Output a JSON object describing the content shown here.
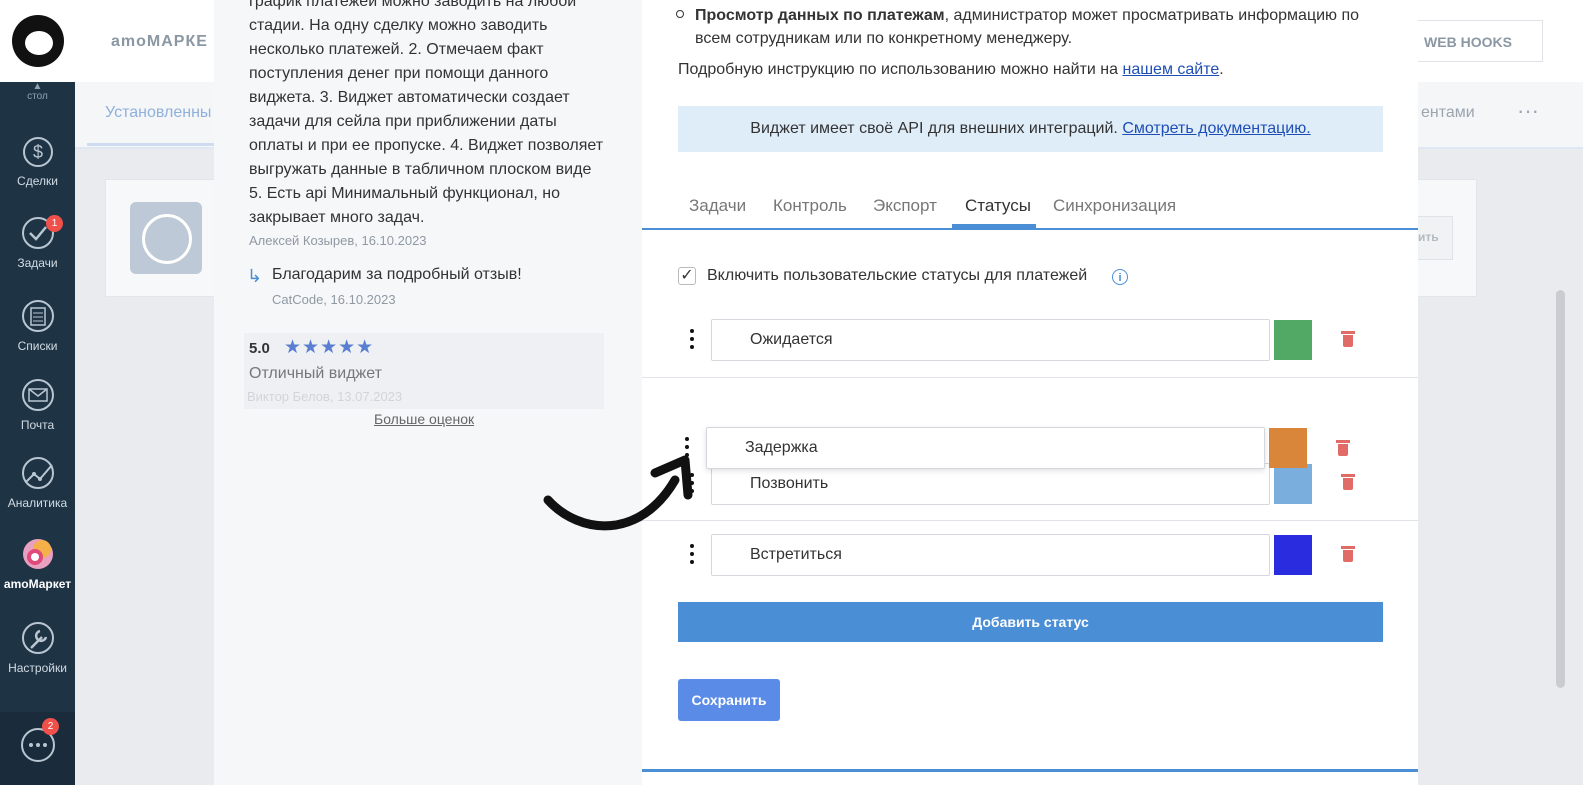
{
  "sidebar": {
    "collapse_label": "стол",
    "items": [
      {
        "label": "Сделки",
        "icon": "dollar-icon"
      },
      {
        "label": "Задачи",
        "icon": "checkmark-icon",
        "badge": "1"
      },
      {
        "label": "Списки",
        "icon": "list-icon"
      },
      {
        "label": "Почта",
        "icon": "mail-icon"
      },
      {
        "label": "Аналитика",
        "icon": "analytics-icon"
      },
      {
        "label": "amoМаркет",
        "icon": "market-icon",
        "active": true
      },
      {
        "label": "Настройки",
        "icon": "wrench-icon"
      }
    ],
    "chat_badge": "2"
  },
  "background": {
    "brand": "amoМАРКЕ",
    "webhooks_label": "WEB HOOKS",
    "tab_left": "Установленны",
    "tab_right": "ентами",
    "tab_more": "···",
    "card_button": "ить"
  },
  "review": {
    "text": "график платежей можно заводить на любой стадии. На одну сделку можно заводить несколько платежей. 2. Отмечаем факт поступления денег при помощи данного виджета. 3. Виджет автоматически создает задачи для сейла при приближении даты оплаты и при ее пропуске. 4. Виджет позволяет выгружать данные в табличном плоском виде 5. Есть api Минимальный функционал, но закрывает много задач.",
    "author": "Алексей Козырев, 16.10.2023",
    "reply_text": "Благодарим за подробный отзыв!",
    "reply_author": "CatCode, 16.10.2023",
    "rating_score": "5.0",
    "rating_stars": "★★★★★",
    "rating_title": "Отличный виджет",
    "rating_faded": "Виктор Белов, 13.07.2023",
    "more_ratings": "Больше оценок"
  },
  "content": {
    "bullet_bold": "Просмотр данных по платежам",
    "bullet_rest": ", администратор может просматривать информацию по всем сотрудникам или по конкретному менеджеру.",
    "instruction_text": "Подробную инструкцию по использованию можно найти на ",
    "instruction_link": "нашем сайте",
    "instruction_end": ".",
    "api_text": "Виджет имеет своё API для внешних интеграций. ",
    "api_link": "Смотреть документацию."
  },
  "tabs": [
    {
      "label": "Задачи"
    },
    {
      "label": "Контроль"
    },
    {
      "label": "Экспорт"
    },
    {
      "label": "Статусы",
      "active": true
    },
    {
      "label": "Синхронизация"
    }
  ],
  "statuses_panel": {
    "checkbox_label": "Включить пользовательские статусы для платежей",
    "checkbox_checked": true,
    "check_mark": "✓",
    "info_symbol": "i",
    "statuses": [
      {
        "name": "Ожидается",
        "color": "#52a865"
      },
      {
        "name": "Задержка",
        "color": "#d9863a",
        "dragging": true
      },
      {
        "name": "Позвонить",
        "color": "#7aaedc"
      },
      {
        "name": "Встретиться",
        "color": "#2a2ce0"
      }
    ],
    "add_status_label": "Добавить статус",
    "save_label": "Сохранить"
  }
}
